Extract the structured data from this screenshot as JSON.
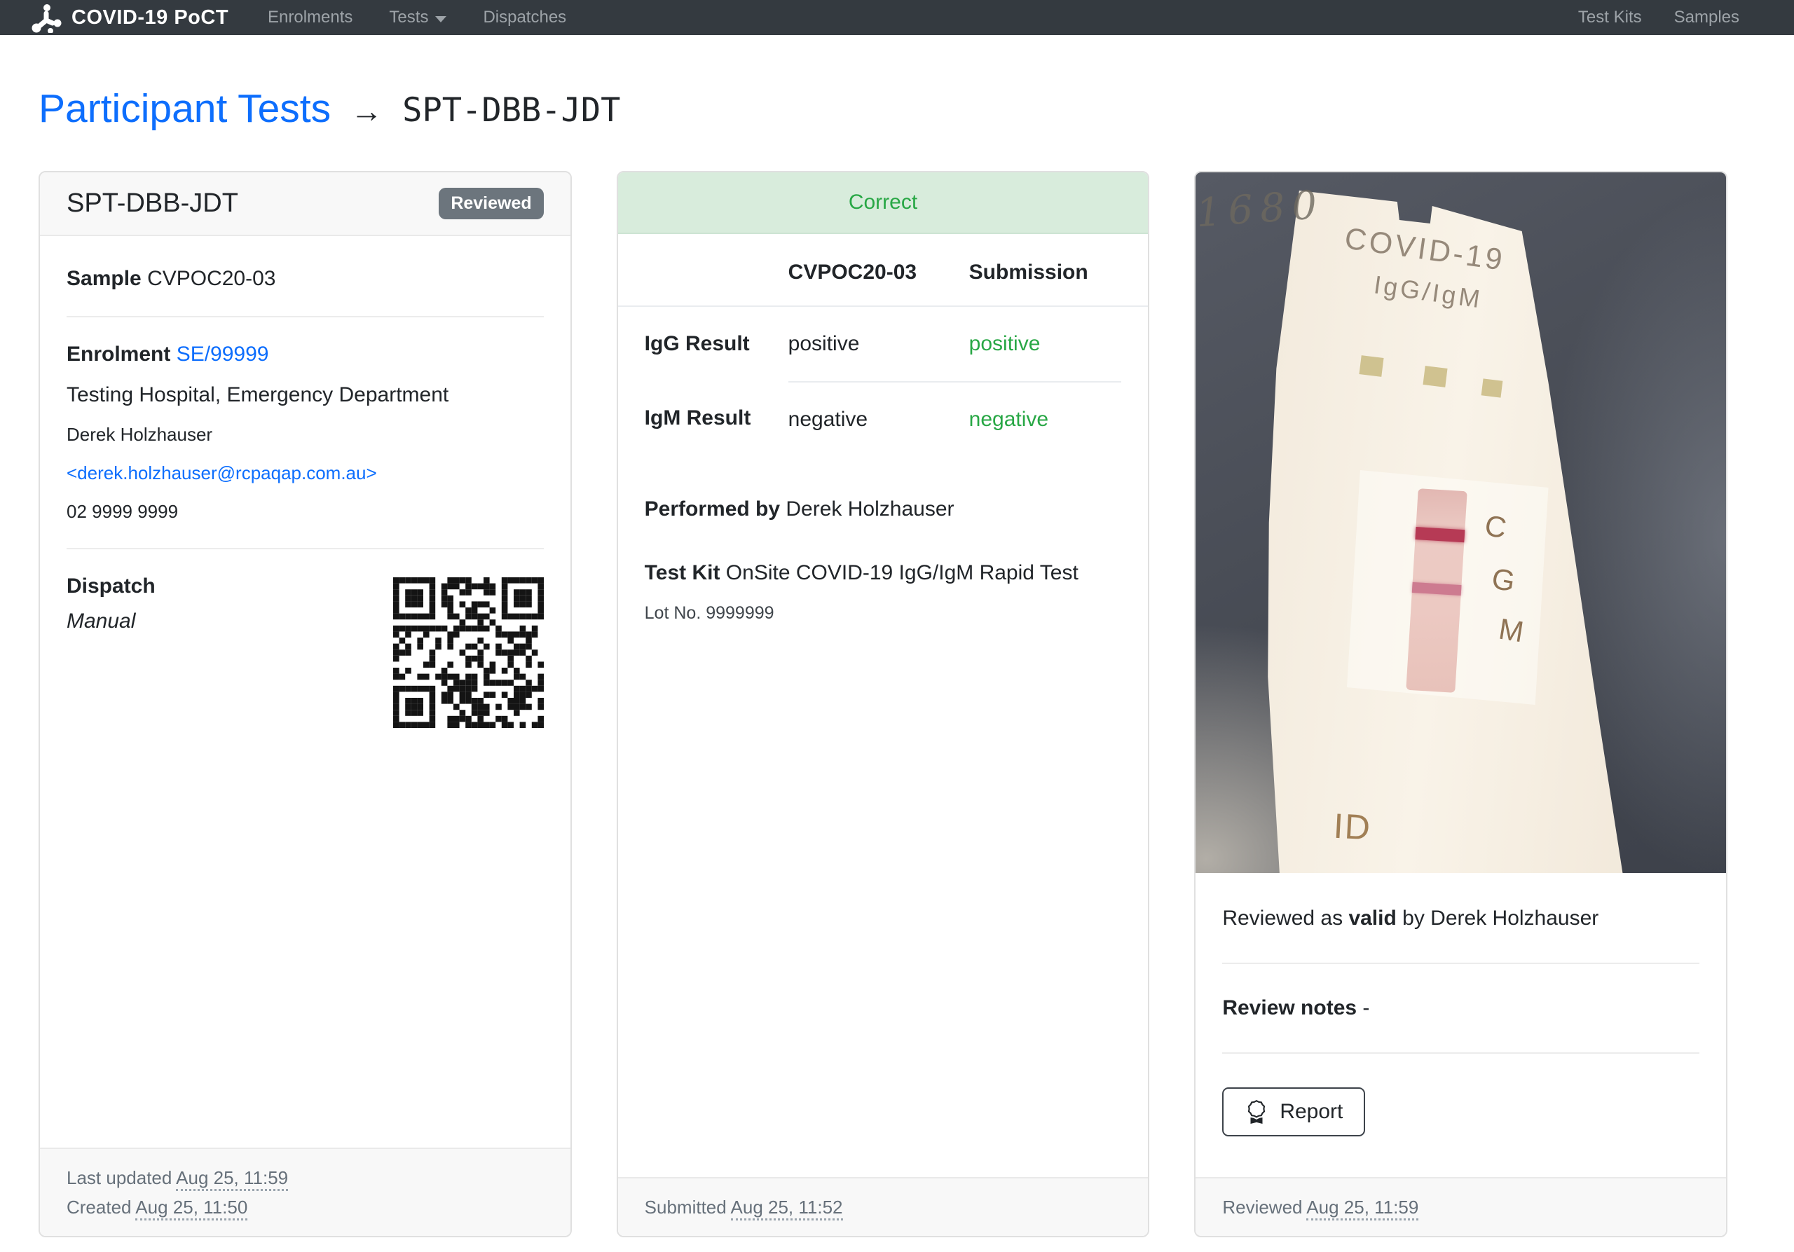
{
  "navbar": {
    "brand": "COVID-19 PoCT",
    "items": [
      {
        "label": "Enrolments"
      },
      {
        "label": "Tests"
      },
      {
        "label": "Dispatches"
      }
    ],
    "right_items": [
      {
        "label": "Test Kits"
      },
      {
        "label": "Samples"
      }
    ]
  },
  "page": {
    "title": "Participant Tests",
    "arrow": "→",
    "code": "SPT-DBB-JDT"
  },
  "test_card": {
    "title": "SPT-DBB-JDT",
    "badge": "Reviewed",
    "sample_label": "Sample",
    "sample_value": "CVPOC20-03",
    "enrolment_label": "Enrolment",
    "enrolment_link": "SE/99999",
    "site": "Testing Hospital, Emergency Department",
    "contact_name": "Derek Holzhauser",
    "contact_email": "<derek.holzhauser@rcpaqap.com.au>",
    "contact_phone": "02 9999 9999",
    "dispatch_label": "Dispatch",
    "dispatch_value": "Manual",
    "footer_updated_label": "Last updated",
    "footer_updated_time": "Aug 25, 11:59",
    "footer_created_label": "Created",
    "footer_created_time": "Aug 25, 11:50"
  },
  "submission_card": {
    "status": "Correct",
    "table": {
      "columns": [
        "CVPOC20-03",
        "Submission"
      ],
      "rows": [
        {
          "label": "IgG Result",
          "expected": "positive",
          "submitted": "positive"
        },
        {
          "label": "IgM Result",
          "expected": "negative",
          "submitted": "negative"
        }
      ]
    },
    "performed_by_label": "Performed by",
    "performed_by": "Derek Holzhauser",
    "test_kit_label": "Test Kit",
    "test_kit": "OnSite COVID-19 IgG/IgM Rapid Test",
    "lot_no": "Lot No. 9999999",
    "footer_label": "Submitted",
    "footer_time": "Aug 25, 11:52"
  },
  "review_card": {
    "photo": {
      "device_title": "COVID-19",
      "device_subtitle": "IgG/IgM",
      "handwritten": "1680",
      "line_labels": [
        "C",
        "G",
        "M"
      ],
      "id_label": "ID"
    },
    "reviewed_prefix": "Reviewed as",
    "reviewed_status": "valid",
    "reviewed_suffix": "by Derek Holzhauser",
    "notes_label": "Review notes",
    "notes_value": "-",
    "report_button": "Report",
    "footer_label": "Reviewed",
    "footer_time": "Aug 25, 11:59"
  },
  "colors": {
    "navbar_bg": "#343a40",
    "link_blue": "#0d6efd",
    "success_green": "#28a745",
    "success_bg": "#d8ecdc",
    "badge_gray": "#6c757d"
  }
}
